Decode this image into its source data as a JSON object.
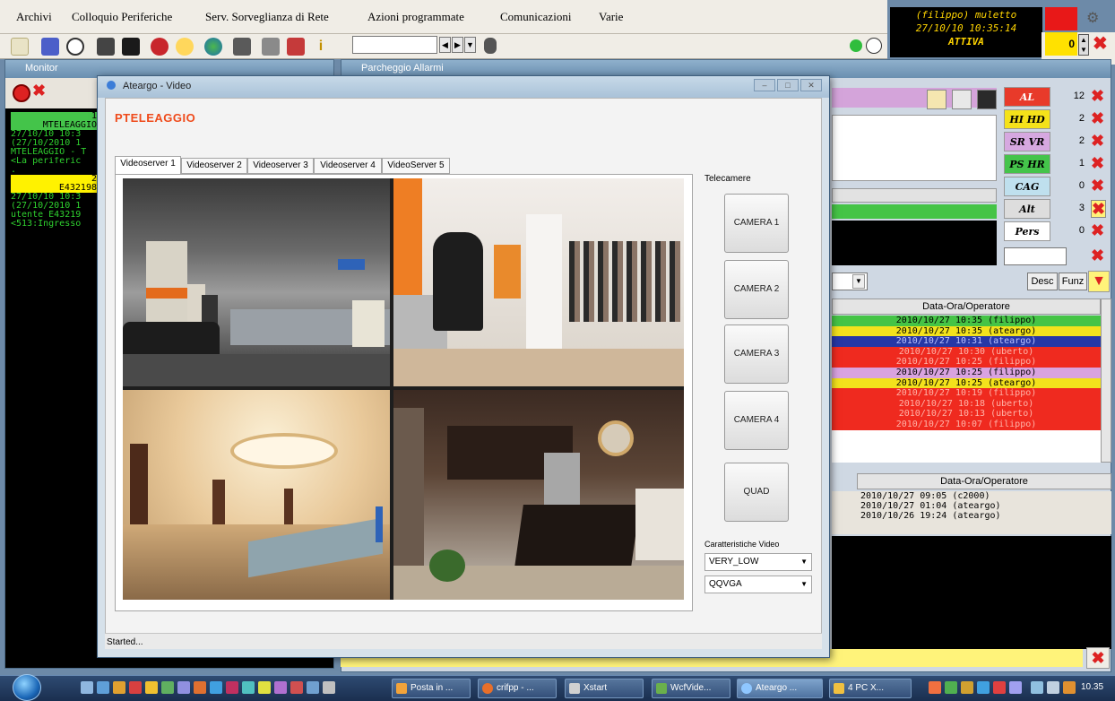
{
  "menubar": {
    "items": [
      "Archivi",
      "Colloquio Periferiche",
      "Serv. Sorveglianza di Rete",
      "Azioni programmate",
      "Comunicazioni",
      "Varie"
    ]
  },
  "status": {
    "user": "(filippo) muletto",
    "datetime": "27/10/10 10:35:14",
    "state": "ATTIVA",
    "counter": "0"
  },
  "monitor": {
    "title": "Monitor",
    "lines": [
      {
        "text": "1",
        "style": "head-green"
      },
      {
        "text": "MTELEAGGIO",
        "style": "head-green"
      },
      {
        "text": "27/10/10  10:3",
        "style": "green"
      },
      {
        "text": " (27/10/2010 1",
        "style": "green"
      },
      {
        "text": "MTELEAGGIO - T",
        "style": "green"
      },
      {
        "text": " <La periferic",
        "style": "green"
      },
      {
        "text": ".",
        "style": "green"
      },
      {
        "text": "",
        "style": "green"
      },
      {
        "text": "2",
        "style": "head-yellow"
      },
      {
        "text": "E432198",
        "style": "head-yellow"
      },
      {
        "text": "27/10/10  10:3",
        "style": "green"
      },
      {
        "text": " (27/10/2010 1",
        "style": "green"
      },
      {
        "text": "utente E43219",
        "style": "green"
      },
      {
        "text": "<513:Ingresso",
        "style": "green"
      }
    ]
  },
  "alarms": {
    "title": "Parcheggio Allarmi",
    "counters": [
      {
        "label": "AL",
        "count": "12",
        "bg": "#e83a2a",
        "color": "#ffffff"
      },
      {
        "label": "HI  HD",
        "count": "2",
        "bg": "#f5e21a",
        "color": "#000000"
      },
      {
        "label": "SR  VR",
        "count": "2",
        "bg": "#d6a8e0",
        "color": "#000000"
      },
      {
        "label": "PS  HR",
        "count": "1",
        "bg": "#44c44a",
        "color": "#000000"
      },
      {
        "label": "CAG",
        "count": "0",
        "bg": "#bfe0ee",
        "color": "#000000"
      },
      {
        "label": "Alt",
        "count": "3",
        "bg": "#dddddd",
        "color": "#000000"
      },
      {
        "label": "Pers",
        "count": "0",
        "bg": "#ffffff",
        "color": "#000000"
      }
    ],
    "buttons": {
      "desc": "Desc",
      "funz": "Funz"
    },
    "grid1_header": "Data-Ora/Operatore",
    "grid1_rows": [
      {
        "text": "2010/10/27 10:35 (filippo)",
        "bg": "#45c446"
      },
      {
        "text": "2010/10/27 10:35 (ateargo)",
        "bg": "#f3e21c"
      },
      {
        "text": "2010/10/27 10:31 (ateargo)",
        "bg": "#2637a6"
      },
      {
        "text": "2010/10/27 10:30 (uberto)",
        "bg": "#ef2a1f"
      },
      {
        "text": "2010/10/27 10:25 (filippo)",
        "bg": "#ef2a1f"
      },
      {
        "text": "2010/10/27 10:25 (filippo)",
        "bg": "#d9a3e0"
      },
      {
        "text": "2010/10/27 10:25 (ateargo)",
        "bg": "#f3e21c"
      },
      {
        "text": "2010/10/27 10:19 (filippo)",
        "bg": "#ef2a1f"
      },
      {
        "text": "2010/10/27 10:18 (uberto)",
        "bg": "#ef2a1f"
      },
      {
        "text": "2010/10/27 10:13 (uberto)",
        "bg": "#ef2a1f"
      },
      {
        "text": "2010/10/27 10:07 (filippo)",
        "bg": "#ef2a1f"
      }
    ],
    "grid2_header": "Data-Ora/Operatore",
    "grid2_rows": [
      "2010/10/27 09:05 (c2000)",
      "2010/10/27 01:04 (ateargo)",
      "2010/10/26 19:24 (ateargo)"
    ]
  },
  "video": {
    "title": "Ateargo - Video",
    "brand": "PTELEAGGIO",
    "tabs": [
      "Videoserver 1",
      "Videoserver 2",
      "Videoserver 3",
      "Videoserver 4",
      "VideoServer 5"
    ],
    "cameras_label": "Telecamere",
    "cameras": [
      "CAMERA 1",
      "CAMERA 2",
      "CAMERA 3",
      "CAMERA 4",
      "QUAD"
    ],
    "features_label": "Caratteristiche Video",
    "quality": "VERY_LOW",
    "resolution": "QQVGA",
    "status": "Started..."
  },
  "taskbar": {
    "tasks": [
      "Posta in ...",
      "crifpp - ...",
      "Xstart",
      "WcfVide...",
      "Ateargo ...",
      "4 PC X..."
    ],
    "clock": "10.35"
  }
}
